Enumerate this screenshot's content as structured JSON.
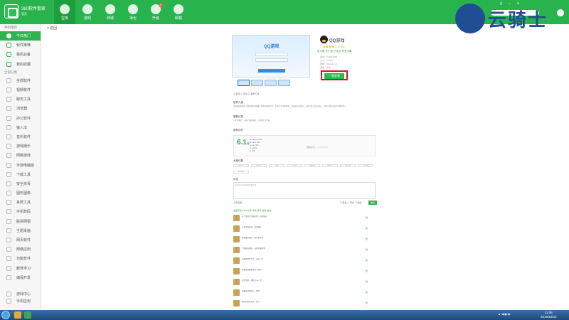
{
  "app": {
    "title": "360软件管家",
    "subtitle": "管家"
  },
  "nav": [
    {
      "label": "宝库",
      "active": true
    },
    {
      "label": "游戏"
    },
    {
      "label": "商城"
    },
    {
      "label": "净化"
    },
    {
      "label": "升级",
      "badge": "1"
    },
    {
      "label": "卸载"
    }
  ],
  "sidebar": {
    "section1": "特别推荐",
    "items1": [
      "今日热门",
      "软件推荐",
      "装机必备",
      "我的收藏"
    ],
    "section2": "全部分类",
    "items2": [
      "全部软件",
      "视频软件",
      "聊天工具",
      "浏览器",
      "办公软件",
      "输入法",
      "音乐软件",
      "游戏娱乐",
      "网络游戏",
      "手游电脑版",
      "下载工具",
      "安全杀毒",
      "图形图像",
      "系统工具",
      "手机数码",
      "股票网银",
      "主题桌面",
      "网页软件",
      "网络应用",
      "功能软件",
      "教育学习",
      "编程开发"
    ],
    "bottom": [
      "游戏中心",
      "手机应用"
    ]
  },
  "main": {
    "back": "< 返回",
    "app_name": "QQ游戏",
    "stars": "★★★★☆ 4.5分",
    "tags": "官方版 无广告 已认证 安全无毒",
    "meta": [
      "版本：5.18.54048",
      "大小：4.95M",
      "更新：2019-10-22",
      "语言：中文"
    ],
    "install": "一键安装",
    "screenshot_logo": "QQ游戏",
    "checks": "☑ 安全  ☑ 无毒  ☑ 官方下载",
    "intro_title": "软件介绍",
    "intro_text": "QQ游戏是腾讯公司推出的中国最大的休闲游戏平台，汇集了众多棋牌类、休闲竞技类游戏，支持在线与好友同乐，为用户提供丰富的游戏体验。",
    "update_title": "更新记录",
    "update_text": "1.优化体验；2.修复已知问题；3.新增大厅功能",
    "rating_title": "软件评分",
    "score": "6.1",
    "score_unit": "分",
    "dist": [
      "★★★★★ 12%",
      "★★★★ 18%",
      "★★★ 22%",
      "★★ 16%",
      "★ 32%"
    ],
    "your_rate": "我的评分：☆☆☆☆☆",
    "tag_title": "大家印象",
    "tag_list": [
      "棋牌游戏",
      "休闲娱乐",
      "斗地主",
      "欢乐麻将",
      "益智游戏",
      "游戏大厅",
      "好友对战",
      "官方正版",
      "经典游戏"
    ],
    "comment_title": "评论",
    "comment_placeholder": "说说你对这款软件的看法吧...",
    "comment_left": "上传截图",
    "comment_right": "☐ 匿名  ☐ 同步  ☐ 表情",
    "post": "发表",
    "comment_tabs": "全部评论(128)  好评  中评  差评  最新  最热",
    "reviews": [
      {
        "text": "这个游戏平台很好用，游戏很多",
        "likes": "赞"
      },
      {
        "text": "斗地主很好玩，每天都玩",
        "likes": "赞"
      },
      {
        "text": "界面挺好看的，操作也方便",
        "likes": "赞"
      },
      {
        "text": "下载速度挺快，安装也很简单",
        "likes": "赞"
      },
      {
        "text": "老牌游戏平台了，支持一下",
        "likes": "赞"
      },
      {
        "text": "希望能增加更多的小游戏",
        "likes": "赞"
      },
      {
        "text": "还不错吧，偶尔会卡一下",
        "likes": "赞"
      },
      {
        "text": "麻将玩得很开心，推荐",
        "likes": "赞"
      },
      {
        "text": "经典的游戏平台，好评",
        "likes": "赞"
      },
      {
        "text": "很好用，一直在用",
        "likes": "赞"
      }
    ]
  },
  "watermark": "云骑士",
  "taskbar": {
    "time": "11:06",
    "date": "2019/10/22"
  }
}
